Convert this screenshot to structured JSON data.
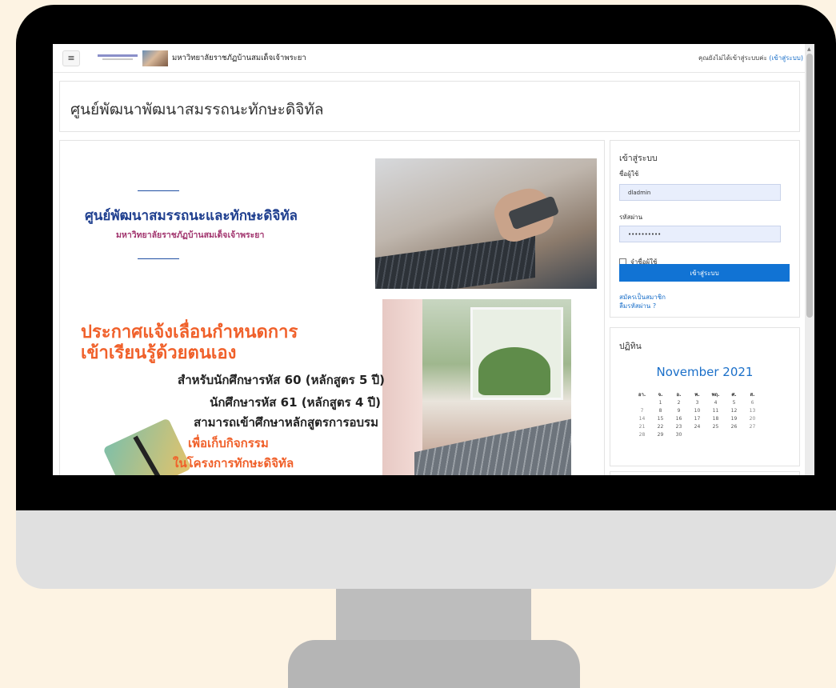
{
  "navbar": {
    "menu_icon": "hamburger-icon",
    "site_name": "มหาวิทยาลัยราชภัฏบ้านสมเด็จเจ้าพระยา",
    "login_status_prefix": "คุณยังไม่ได้เข้าสู่ระบบค่ะ",
    "login_link": "(เข้าสู่ระบบ)"
  },
  "page": {
    "title": "ศูนย์พัฒนาพัฒนาสมรรถนะทักษะดิจิทัล"
  },
  "banner": {
    "title": "ศูนย์พัฒนาสมรรถนะและทักษะดิจิทัล",
    "subtitle": "มหาวิทยาลัยราชภัฏบ้านสมเด็จเจ้าพระยา",
    "announcement_line1": "ประกาศแจ้งเลื่อนกำหนดการ",
    "announcement_line2": "เข้าเรียนรู้ด้วยตนเอง",
    "detail_line1": "สำหรับนักศึกษารหัส 60 (หลักสูตร 5 ปี)",
    "detail_line2": "นักศึกษารหัส 61 (หลักสูตร 4 ปี)",
    "detail_line3": "สามารถเข้าศึกษาหลักสูตรการอบรม",
    "detail_line4": "เพื่อเก็บกิจกรรม",
    "detail_line5": "ในโครงการทักษะดิจิทัล"
  },
  "login_block": {
    "title": "เข้าสู่ระบบ",
    "username_label": "ชื่อผู้ใช้",
    "username_value": "dladmin",
    "password_label": "รหัสผ่าน",
    "password_value": "••••••••••",
    "remember_label": "จำชื่อผู้ใช้",
    "login_button": "เข้าสู่ระบบ",
    "register_link": "สมัครเป็นสมาชิก",
    "forgot_link": "ลืมรหัสผ่าน ?"
  },
  "calendar_block": {
    "title": "ปฏิทิน",
    "month": "November 2021",
    "weekdays": [
      "อา.",
      "จ.",
      "อ.",
      "พ.",
      "พฤ.",
      "ศ.",
      "ส."
    ],
    "weeks": [
      [
        "",
        "1",
        "2",
        "3",
        "4",
        "5",
        "6"
      ],
      [
        "7",
        "8",
        "9",
        "10",
        "11",
        "12",
        "13"
      ],
      [
        "14",
        "15",
        "16",
        "17",
        "18",
        "19",
        "20"
      ],
      [
        "21",
        "22",
        "23",
        "24",
        "25",
        "26",
        "27"
      ],
      [
        "28",
        "29",
        "30",
        "",
        "",
        "",
        ""
      ]
    ]
  }
}
